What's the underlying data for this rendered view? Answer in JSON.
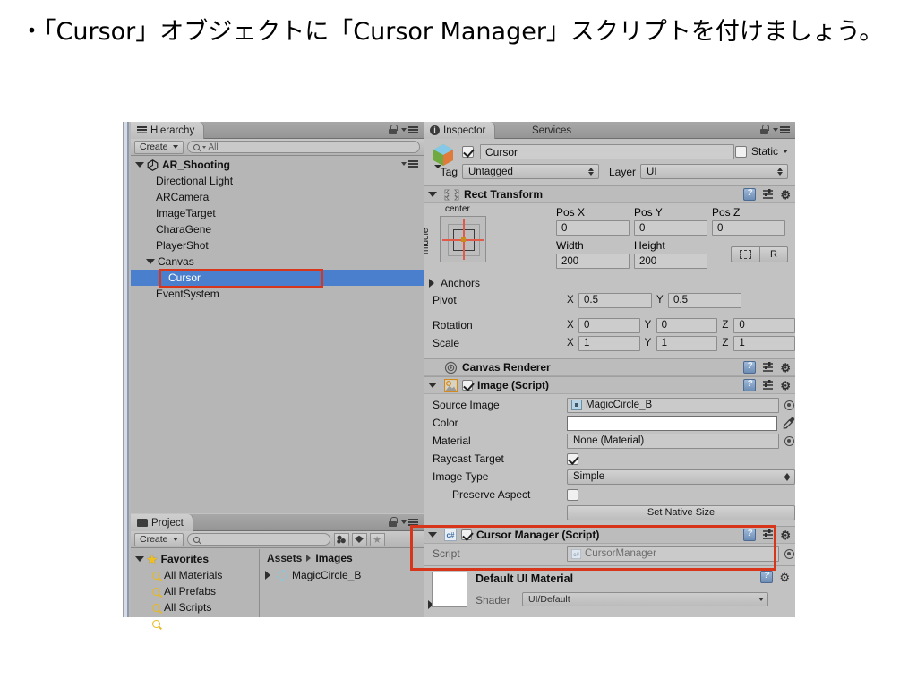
{
  "heading": "・「Cursor」オブジェクトに「Cursor Manager」スクリプトを付けましょう。",
  "colors": {
    "selection_blue": "#4a7fcd",
    "highlight_red": "#d8361b",
    "panel_bg": "#b6b6b6",
    "inspector_bg": "#c2c2c2",
    "favorites_yellow": "#e8b81b"
  },
  "hierarchy": {
    "tab_label": "Hierarchy",
    "create_label": "Create",
    "search_placeholder": "All",
    "items": [
      {
        "label": "AR_Shooting",
        "depth": 0,
        "expanded": true,
        "root": true,
        "selected": false
      },
      {
        "label": "Directional Light",
        "depth": 1,
        "expanded": null,
        "root": false,
        "selected": false
      },
      {
        "label": "ARCamera",
        "depth": 1,
        "expanded": null,
        "root": false,
        "selected": false
      },
      {
        "label": "ImageTarget",
        "depth": 1,
        "expanded": null,
        "root": false,
        "selected": false
      },
      {
        "label": "CharaGene",
        "depth": 1,
        "expanded": null,
        "root": false,
        "selected": false
      },
      {
        "label": "PlayerShot",
        "depth": 1,
        "expanded": null,
        "root": false,
        "selected": false
      },
      {
        "label": "Canvas",
        "depth": 1,
        "expanded": true,
        "root": false,
        "selected": false
      },
      {
        "label": "Cursor",
        "depth": 2,
        "expanded": null,
        "root": false,
        "selected": true
      },
      {
        "label": "EventSystem",
        "depth": 1,
        "expanded": null,
        "root": false,
        "selected": false
      }
    ]
  },
  "project": {
    "tab_label": "Project",
    "create_label": "Create",
    "search_placeholder": "",
    "favorites_label": "Favorites",
    "favorites": [
      "All Materials",
      "All Prefabs",
      "All Scripts"
    ],
    "breadcrumb": [
      "Assets",
      "Images"
    ],
    "assets": [
      {
        "label": "MagicCircle_B"
      }
    ]
  },
  "inspector": {
    "tab_label": "Inspector",
    "tab_services": "Services",
    "object_name": "Cursor",
    "object_enabled": true,
    "static_label": "Static",
    "static_checked": false,
    "tag_label": "Tag",
    "tag_value": "Untagged",
    "layer_label": "Layer",
    "layer_value": "UI",
    "rect_transform": {
      "title": "Rect Transform",
      "anchor_preset_h": "center",
      "anchor_preset_v": "middle",
      "pos_x_label": "Pos X",
      "pos_x": "0",
      "pos_y_label": "Pos Y",
      "pos_y": "0",
      "pos_z_label": "Pos Z",
      "pos_z": "0",
      "width_label": "Width",
      "width": "200",
      "height_label": "Height",
      "height": "200",
      "blueprint_label": "R",
      "anchors_label": "Anchors",
      "pivot_label": "Pivot",
      "pivot_x": "0.5",
      "pivot_y": "0.5",
      "rotation_label": "Rotation",
      "rotation_x": "0",
      "rotation_y": "0",
      "rotation_z": "0",
      "scale_label": "Scale",
      "scale_x": "1",
      "scale_y": "1",
      "scale_z": "1"
    },
    "canvas_renderer": {
      "title": "Canvas Renderer"
    },
    "image_script": {
      "title": "Image (Script)",
      "enabled": true,
      "source_image_label": "Source Image",
      "source_image_value": "MagicCircle_B",
      "color_label": "Color",
      "color_value": "#ffffff",
      "material_label": "Material",
      "material_value": "None (Material)",
      "raycast_target_label": "Raycast Target",
      "raycast_target_checked": true,
      "image_type_label": "Image Type",
      "image_type_value": "Simple",
      "preserve_aspect_label": "Preserve Aspect",
      "preserve_aspect_checked": false,
      "set_native_size_label": "Set Native Size"
    },
    "cursor_manager_script": {
      "title": "Cursor Manager (Script)",
      "enabled": true,
      "script_label": "Script",
      "script_value": "CursorManager",
      "highlighted": true
    },
    "material_block": {
      "title": "Default UI Material",
      "shader_label": "Shader",
      "shader_value": "UI/Default"
    }
  }
}
